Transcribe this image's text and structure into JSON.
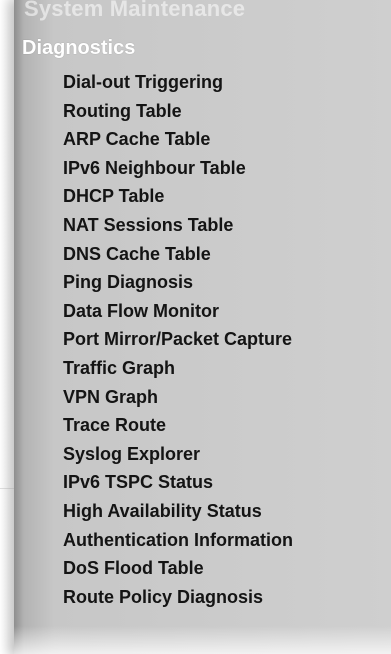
{
  "menu": {
    "top_item": "System Maintenance",
    "section_title": "Diagnostics",
    "items": [
      {
        "label": "Dial-out Triggering"
      },
      {
        "label": "Routing Table"
      },
      {
        "label": "ARP Cache Table"
      },
      {
        "label": "IPv6 Neighbour Table"
      },
      {
        "label": "DHCP Table"
      },
      {
        "label": "NAT Sessions Table"
      },
      {
        "label": "DNS Cache Table"
      },
      {
        "label": "Ping Diagnosis"
      },
      {
        "label": "Data Flow Monitor"
      },
      {
        "label": "Port Mirror/Packet Capture"
      },
      {
        "label": "Traffic Graph"
      },
      {
        "label": "VPN Graph"
      },
      {
        "label": "Trace Route"
      },
      {
        "label": "Syslog Explorer"
      },
      {
        "label": "IPv6 TSPC Status"
      },
      {
        "label": "High Availability Status"
      },
      {
        "label": "Authentication Information"
      },
      {
        "label": "DoS Flood Table"
      },
      {
        "label": "Route Policy Diagnosis"
      }
    ]
  },
  "colors": {
    "panel_background": "#cfcfcf",
    "header_text": "#ffffff",
    "item_text": "#141414"
  }
}
